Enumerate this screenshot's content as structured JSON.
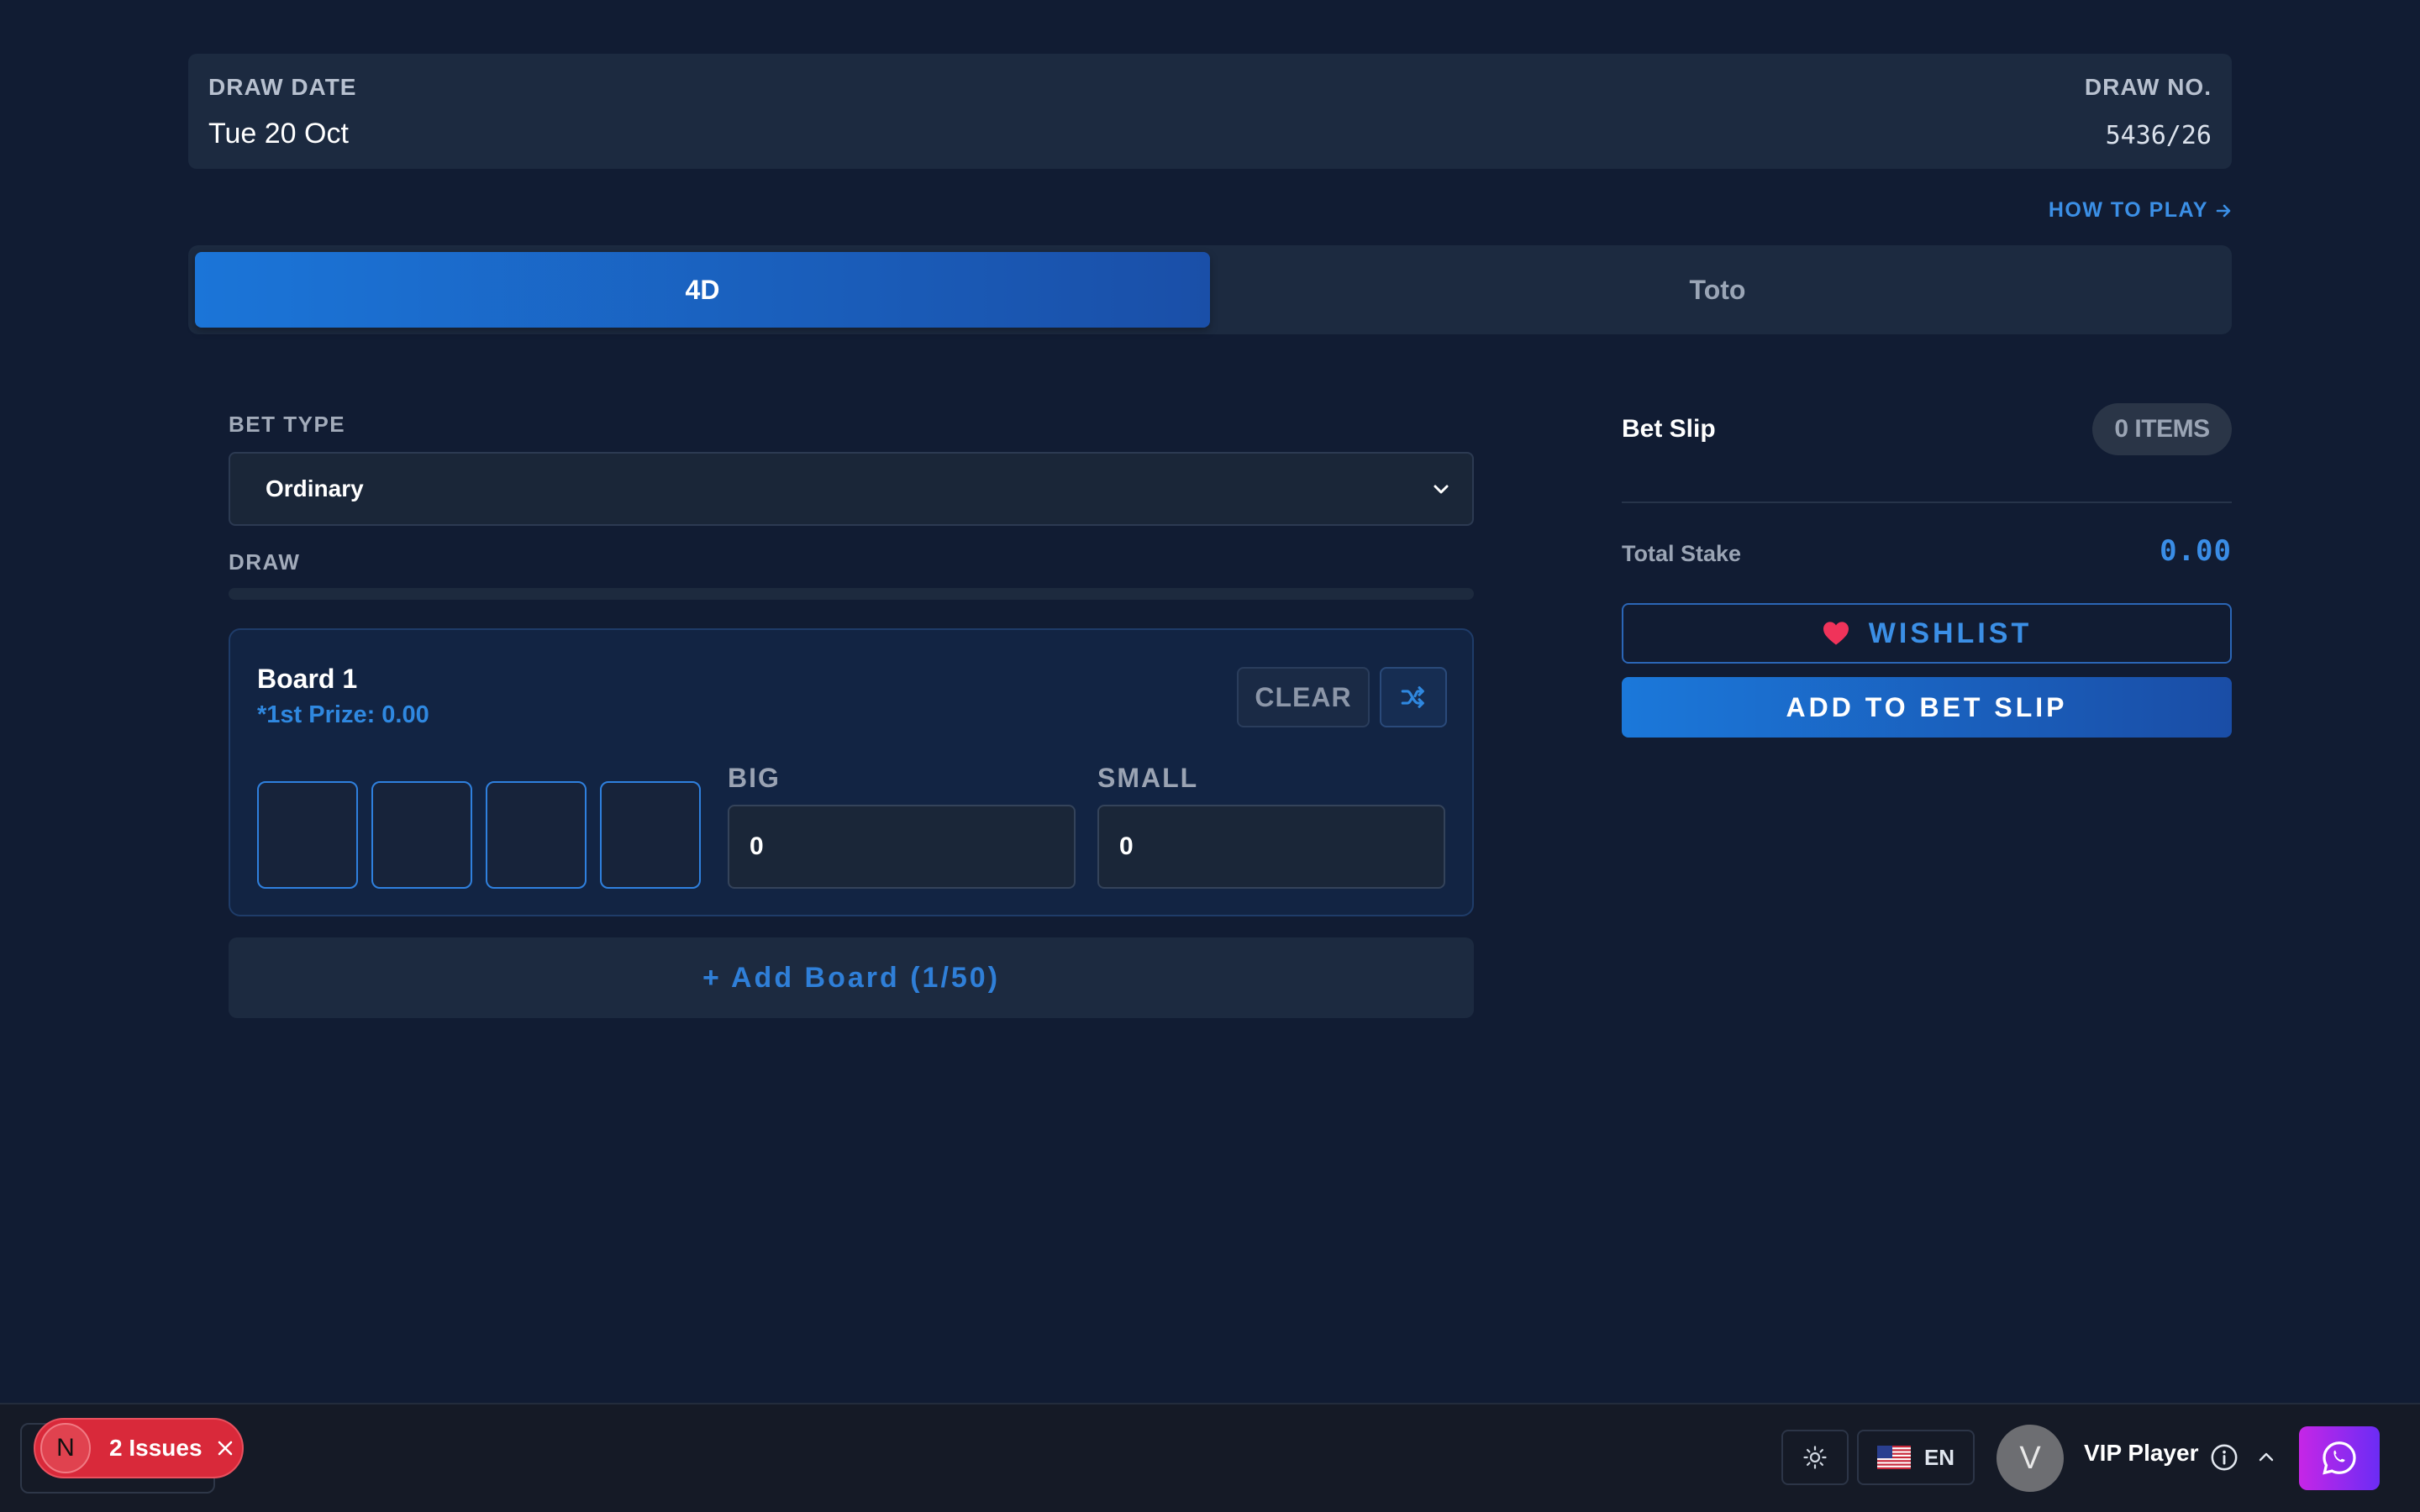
{
  "draw_info": {
    "date_label": "DRAW DATE",
    "date_value": "Tue 20 Oct",
    "number_label": "DRAW NO.",
    "number_value": "5436/26"
  },
  "how_to_play": "HOW TO PLAY",
  "tabs": [
    {
      "label": "4D",
      "active": true
    },
    {
      "label": "Toto",
      "active": false
    }
  ],
  "form": {
    "bet_type_label": "BET TYPE",
    "bet_type_value": "Ordinary",
    "draw_label": "DRAW"
  },
  "board": {
    "title": "Board 1",
    "prize": "*1st Prize: 0.00",
    "clear_label": "CLEAR",
    "digits": [
      "",
      "",
      "",
      ""
    ],
    "big_label": "BIG",
    "big_value": "0",
    "small_label": "SMALL",
    "small_value": "0"
  },
  "add_board_label": "+ Add Board (1/50)",
  "bet_slip": {
    "title": "Bet Slip",
    "items_badge": "0 ITEMS",
    "total_label": "Total Stake",
    "total_value": "0.00",
    "wishlist_label": "WISHLIST",
    "add_label": "ADD TO BET SLIP"
  },
  "bottom_bar": {
    "issues_badge": "N",
    "issues_label": "2 Issues",
    "language": "EN",
    "avatar_initial": "V",
    "player_name": "VIP Player"
  },
  "icons": {
    "how_to_play_arrow": "arrow-right-icon",
    "select_chevron": "chevron-down-icon",
    "shuffle": "shuffle-icon",
    "wishlist": "heart-icon",
    "theme": "sun-icon",
    "flag": "us-flag-icon",
    "info": "info-icon",
    "caret": "chevron-up-icon",
    "chat": "whatsapp-icon",
    "issues_close": "close-icon"
  },
  "colors": {
    "background": "#111c33",
    "accent": "#2f88e0",
    "card": "#1c2a40",
    "issues": "#d9293a",
    "wishlist_heart": "#f0335a"
  }
}
